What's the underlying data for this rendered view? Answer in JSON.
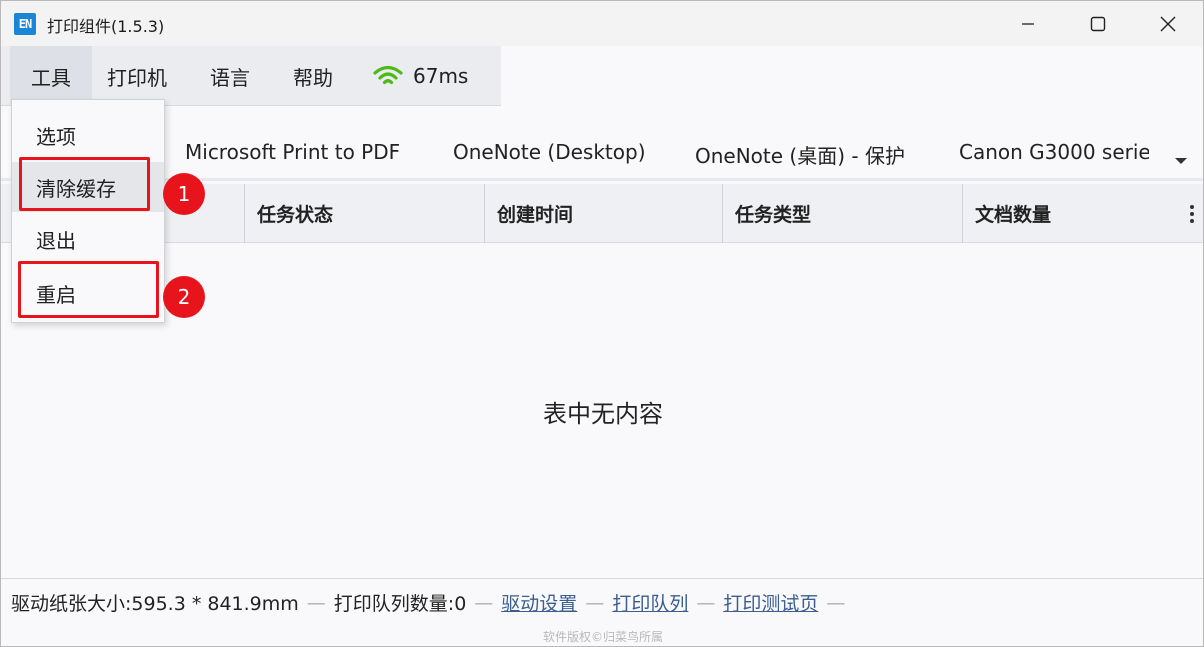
{
  "window": {
    "title": "打印组件(1.5.3)",
    "icon_text": "EN"
  },
  "menubar": {
    "tools": "工具",
    "printer": "打印机",
    "language": "语言",
    "help": "帮助",
    "ping": "67ms",
    "ping_icon": "wifi-icon",
    "ping_color": "#4cbb17"
  },
  "tools_menu": {
    "items": [
      {
        "label": "选项"
      },
      {
        "label": "清除缓存"
      },
      {
        "label": "退出"
      },
      {
        "label": "重启"
      }
    ]
  },
  "printer_tabs": [
    {
      "label": "Microsoft Print to PDF"
    },
    {
      "label": "OneNote (Desktop)"
    },
    {
      "label": "OneNote (桌面) - 保护"
    },
    {
      "label": "Canon G3000 serie"
    }
  ],
  "table": {
    "columns": [
      "",
      "任务状态",
      "创建时间",
      "任务类型",
      "文档数量"
    ],
    "empty_text": "表中无内容"
  },
  "statusbar": {
    "paper_size": "驱动纸张大小:595.3 * 841.9mm",
    "queue_count": "打印队列数量:0",
    "driver_settings": "驱动设置",
    "print_queue": "打印队列",
    "print_test_page": "打印测试页",
    "separator": "—"
  },
  "footer": {
    "copyright": "软件版权©归菜鸟所属"
  },
  "annotations": {
    "marker_1": "1",
    "marker_2": "2",
    "color": "#e8141c"
  }
}
